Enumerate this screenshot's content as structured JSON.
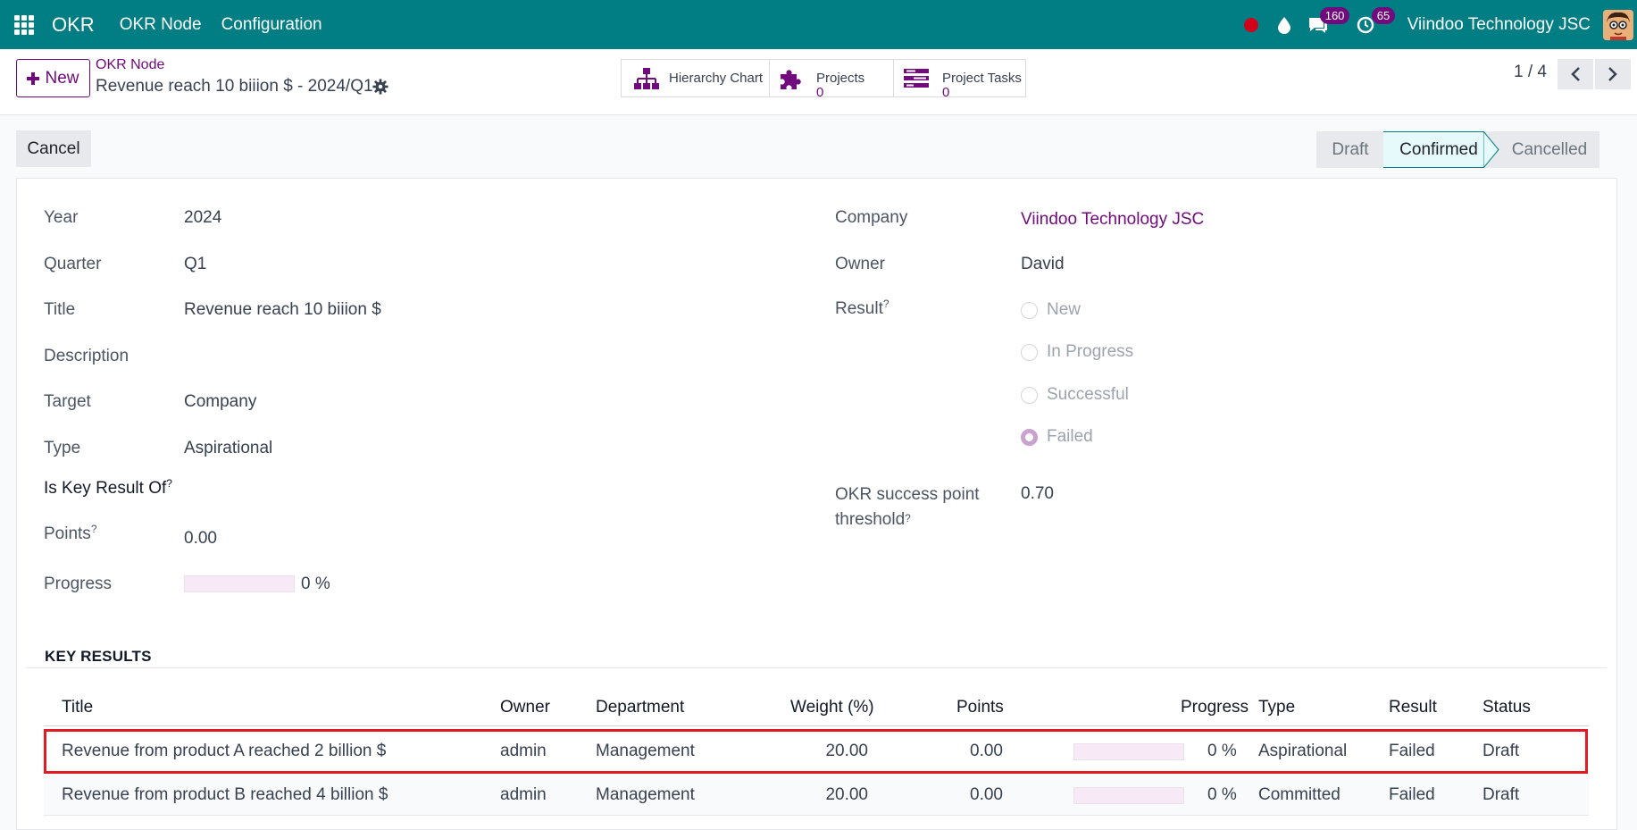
{
  "navbar": {
    "app_name": "OKR",
    "menu_items": [
      "OKR Node",
      "Configuration"
    ],
    "messages_count": "160",
    "activities_count": "65",
    "company": "Viindoo Technology JSC"
  },
  "control_panel": {
    "new_label": "New",
    "breadcrumb_parent": "OKR Node",
    "record_title": "Revenue reach 10 biiion $ - 2024/Q1",
    "smart_buttons": [
      {
        "label": "Hierarchy Chart",
        "value": ""
      },
      {
        "label": "Projects",
        "value": "0"
      },
      {
        "label": "Project Tasks",
        "value": "0"
      }
    ],
    "pager": "1 / 4"
  },
  "header": {
    "cancel_label": "Cancel",
    "statuses": [
      "Draft",
      "Confirmed",
      "Cancelled"
    ],
    "active_status": "Confirmed"
  },
  "form": {
    "year": {
      "label": "Year",
      "value": "2024"
    },
    "quarter": {
      "label": "Quarter",
      "value": "Q1"
    },
    "title": {
      "label": "Title",
      "value": "Revenue reach 10 biiion $"
    },
    "description": {
      "label": "Description",
      "value": ""
    },
    "target": {
      "label": "Target",
      "value": "Company"
    },
    "type": {
      "label": "Type",
      "value": "Aspirational"
    },
    "is_key_result_of": {
      "label": "Is Key Result Of",
      "value": ""
    },
    "points": {
      "label": "Points",
      "value": "0.00"
    },
    "progress": {
      "label": "Progress",
      "value": "0 %",
      "fraction": 0
    },
    "company": {
      "label": "Company",
      "value": "Viindoo Technology JSC"
    },
    "owner": {
      "label": "Owner",
      "value": "David"
    },
    "result": {
      "label": "Result",
      "options": [
        "New",
        "In Progress",
        "Successful",
        "Failed"
      ],
      "selected": "Failed"
    },
    "threshold": {
      "label_line1": "OKR success point",
      "label_line2": "threshold",
      "value": "0.70"
    },
    "help_mark": "?"
  },
  "key_results": {
    "section_title": "KEY RESULTS",
    "columns": [
      "Title",
      "Owner",
      "Department",
      "Weight (%)",
      "Points",
      "Progress",
      "Type",
      "Result",
      "Status"
    ],
    "rows": [
      {
        "title": "Revenue from product A reached 2 billion $",
        "owner": "admin",
        "department": "Management",
        "weight": "20.00",
        "points": "0.00",
        "progress": "0 %",
        "type": "Aspirational",
        "result": "Failed",
        "status": "Draft"
      },
      {
        "title": "Revenue from product B reached 4 billion $",
        "owner": "admin",
        "department": "Management",
        "weight": "20.00",
        "points": "0.00",
        "progress": "0 %",
        "type": "Committed",
        "result": "Failed",
        "status": "Draft"
      }
    ]
  },
  "colors": {
    "brand": "#017e84",
    "accent": "#710a7c",
    "highlight": "#e01b24"
  }
}
